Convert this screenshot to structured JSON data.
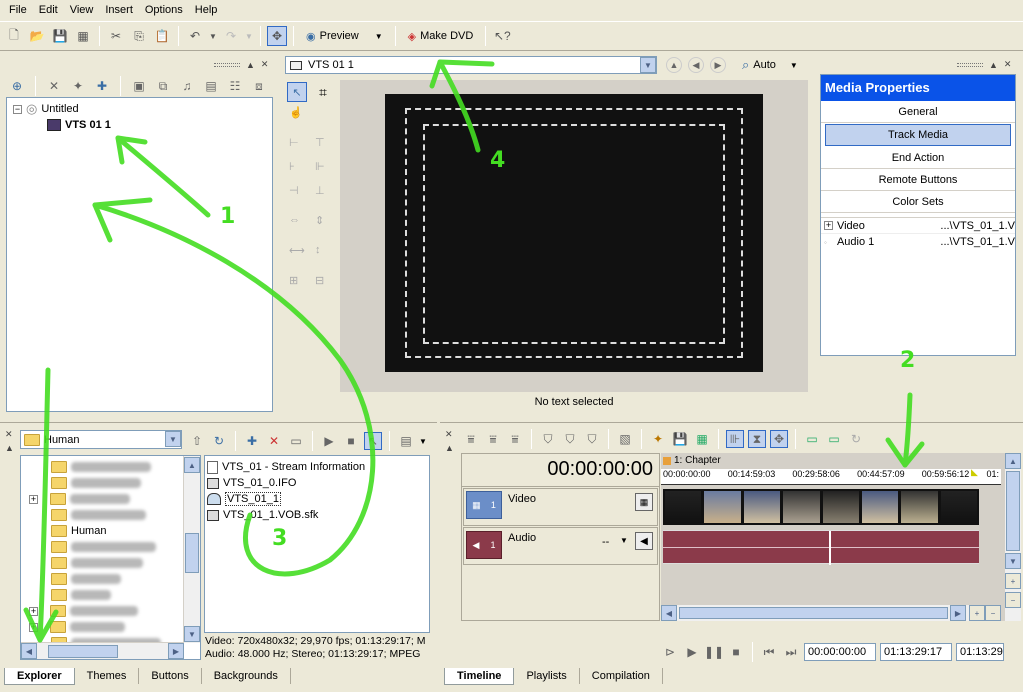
{
  "menu": [
    "File",
    "Edit",
    "View",
    "Insert",
    "Options",
    "Help"
  ],
  "toolbar": {
    "preview_label": "Preview",
    "make_dvd_label": "Make DVD"
  },
  "project_tree": {
    "root": "Untitled",
    "child": "VTS 01 1"
  },
  "editor": {
    "selector_value": "VTS 01 1",
    "zoom_value": "Auto",
    "status": "No text selected"
  },
  "media_properties": {
    "title": "Media Properties",
    "buttons": [
      "General",
      "Track Media",
      "End Action",
      "Remote Buttons",
      "Color Sets"
    ],
    "rows": [
      {
        "name": "Video",
        "value": "...\\VTS_01_1.V"
      },
      {
        "name": "Audio 1",
        "value": "...\\VTS_01_1.V"
      }
    ]
  },
  "explorer": {
    "folder_value": "Human",
    "tree_label": "Human",
    "files": [
      "VTS_01 - Stream Information",
      "VTS_01_0.IFO",
      "VTS_01_1",
      "VTS_01_1.VOB.sfk"
    ],
    "info_line1": "Video: 720x480x32; 29,970 fps; 01:13:29:17; M",
    "info_line2": "Audio: 48.000 Hz; Stereo; 01:13:29:17; MPEG"
  },
  "bottom_tabs_left": [
    "Explorer",
    "Themes",
    "Buttons",
    "Backgrounds"
  ],
  "timeline": {
    "timecode": "00:00:00:00",
    "chapter": "1: Chapter",
    "ruler": [
      "00:00:00:00",
      "00:14:59:03",
      "00:29:58:06",
      "00:44:57:09",
      "00:59:56:12",
      "01:"
    ],
    "video_track": "Video",
    "audio_track": "Audio",
    "track_num": "1",
    "audio_dash": "--",
    "time_start": "00:00:00:00",
    "time_end": "01:13:29:17",
    "time_len": "01:13:29"
  },
  "bottom_tabs_right": [
    "Timeline",
    "Playlists",
    "Compilation"
  ],
  "annotations": [
    "1",
    "2",
    "3",
    "4"
  ],
  "colors": {
    "accent": "#316ac5",
    "title_bar": "#0a53e8",
    "annotation": "#44dd22",
    "audio_track": "#8b3a4a"
  }
}
